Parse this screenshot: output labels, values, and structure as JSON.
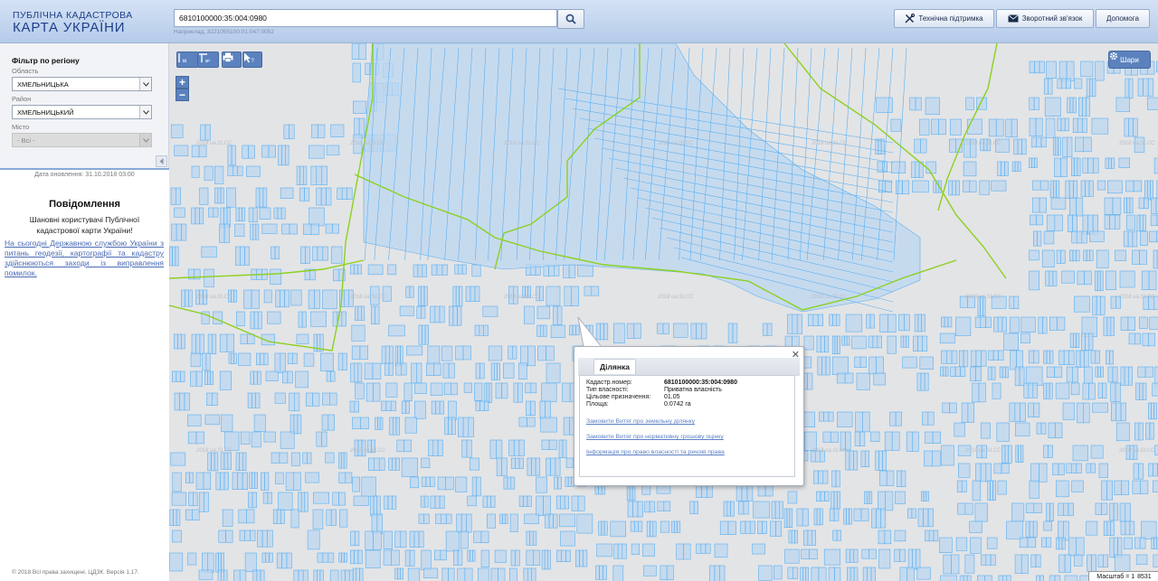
{
  "header": {
    "logo_line1": "ПУБЛІЧНА КАДАСТРОВА",
    "logo_line2": "КАРТА УКРАЇНИ",
    "search_value": "6810100000:35:004:0980",
    "search_hint": "Наприклад, 3221055100:01:047:0052",
    "search_icon": "search-icon",
    "buttons": {
      "support": "Технічна підтримка",
      "feedback": "Зворотний зв'язок",
      "help": "Допомога"
    }
  },
  "sidebar": {
    "filter_title": "Фільтр по регіону",
    "region_label": "Область",
    "region_value": "ХМЕЛЬНИЦЬКА",
    "district_label": "Район",
    "district_value": "ХМЕЛЬНИЦЬКИЙ",
    "city_label": "Місто",
    "city_value": "- Всі -",
    "update_date": "Дата оновлення: 31.10.2018 03:00",
    "notice_title": "Повідомлення",
    "notice_text": "Шановні користувачі Публічної кадастрової карти України!",
    "notice_link": "На сьогодні Державною службою України з питань геодезії, картографії та кадастру здійснюються заходи із виправлення помилок.",
    "copyright": "© 2018 Всі права захищені. ЦДЗК. Версія 1.17."
  },
  "map": {
    "watermark": "2018 ua.SLCC",
    "layers_label": "Шари",
    "scale_label": "Масштаб = 1",
    "scale_value": "8531",
    "parcel_fill": "#bcd7f0",
    "parcel_stroke": "#5ab0f0",
    "boundary_color": "#8bd11f",
    "background": "#e3e4e6"
  },
  "popup": {
    "tab_label": "Ділянка",
    "rows": [
      {
        "label": "Кадастр.номер:",
        "value": "6810100000:35:004:0980"
      },
      {
        "label": "Тип власності:",
        "value": "Приватна власність"
      },
      {
        "label": "Цільове призначення:",
        "value": "01.05"
      },
      {
        "label": "Площа:",
        "value": "0.0742 га"
      }
    ],
    "links": [
      "Замовити Витяг про земельну ділянку",
      "Замовити Витяг про нормативну грошову оцінку",
      "Інформація про право власності та речові права"
    ]
  }
}
